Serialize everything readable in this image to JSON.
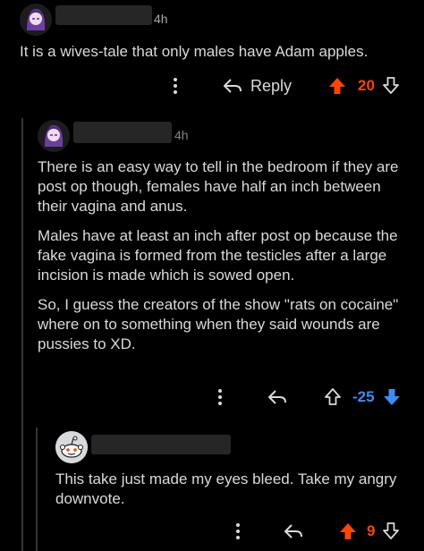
{
  "colors": {
    "background": "#000000",
    "text": "#d7dadc",
    "muted": "#818384",
    "upvote": "#ff4500",
    "downvote": "#3d8cf5",
    "thread_line": "#343536"
  },
  "comments": [
    {
      "avatar": "anime-avatar",
      "time": "4h",
      "body": [
        "It is a wives-tale that only males have Adam apples."
      ],
      "actions": {
        "more_icon": "more-vertical-icon",
        "reply_icon": "reply-arrow-icon",
        "reply_label": "Reply",
        "upvote_icon": "upvote-arrow-icon",
        "score": "20",
        "downvote_icon": "downvote-arrow-icon",
        "vote_state": "upvoted"
      }
    },
    {
      "avatar": "anime-avatar",
      "time": "4h",
      "body": [
        "There is an easy way to tell in the bedroom if they are post op though, females have half an inch between their vagina and anus.",
        "Males have at least an inch after post op because the fake vagina is formed from the testicles after a large incision is made which is sowed open.",
        "So, I guess the creators of the show \"rats on cocaine\" where on to something when they said wounds are pussies to XD."
      ],
      "actions": {
        "more_icon": "more-vertical-icon",
        "reply_icon": "reply-arrow-icon",
        "upvote_icon": "upvote-arrow-icon",
        "score": "-25",
        "downvote_icon": "downvote-arrow-icon",
        "vote_state": "downvoted"
      }
    },
    {
      "avatar": "snoo-avatar",
      "body": [
        "This take just made my eyes bleed. Take my angry downvote."
      ],
      "actions": {
        "more_icon": "more-vertical-icon",
        "reply_icon": "reply-arrow-icon",
        "upvote_icon": "upvote-arrow-icon",
        "score": "9",
        "downvote_icon": "downvote-arrow-icon",
        "vote_state": "upvoted"
      }
    }
  ]
}
